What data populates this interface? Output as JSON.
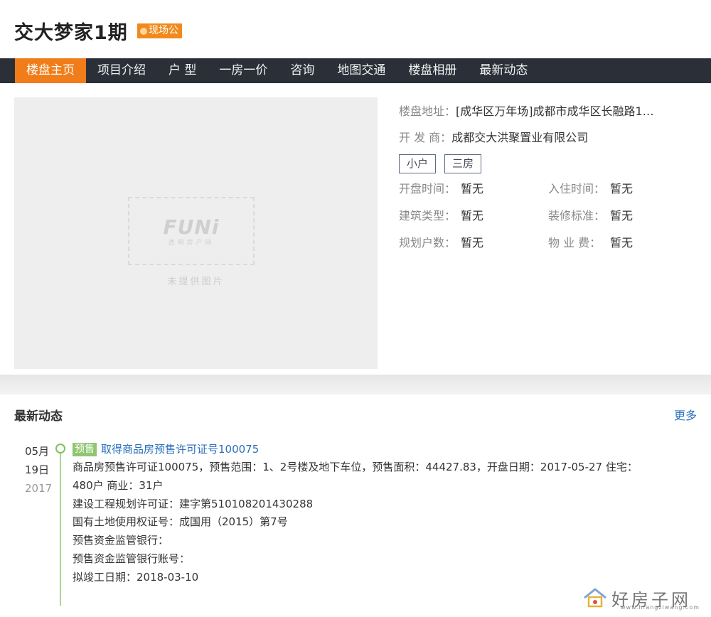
{
  "header": {
    "title": "交大梦家1期",
    "badge": "现场公"
  },
  "nav": {
    "items": [
      "楼盘主页",
      "项目介绍",
      "户 型",
      "一房一价",
      "咨询",
      "地图交通",
      "楼盘相册",
      "最新动态"
    ]
  },
  "photo": {
    "logo": "FUNi",
    "logo_sub": "透明房产网",
    "caption": "未提供图片"
  },
  "info": {
    "address_label": "楼盘地址：",
    "address_value": "[成华区万年场]成都市成华区长融路1…",
    "developer_label": "开 发 商：",
    "developer_value": "成都交大洪聚置业有限公司",
    "tags": [
      "小户",
      "三房"
    ],
    "fields": [
      {
        "label": "开盘时间：",
        "value": "暂无"
      },
      {
        "label": "入住时间：",
        "value": "暂无"
      },
      {
        "label": "建筑类型：",
        "value": "暂无"
      },
      {
        "label": "装修标准：",
        "value": "暂无"
      },
      {
        "label": "规划户数：",
        "value": "暂无"
      },
      {
        "label": "物 业 费：",
        "value": "暂无"
      }
    ]
  },
  "news": {
    "title": "最新动态",
    "more": "更多",
    "item": {
      "month": "05月",
      "day": "19日",
      "year": "2017",
      "tag": "预售",
      "headline": "取得商品房预售许可证号100075",
      "lines": [
        "商品房预售许可证100075，预售范围：1、2号楼及地下车位，预售面积：44427.83，开盘日期：2017-05-27 住宅：",
        "480户 商业：31户",
        "建设工程规划许可证：建字第510108201430288",
        "国有土地使用权证号：成国用（2015）第7号",
        "预售资金监管银行：",
        "预售资金监管银行账号：",
        "拟竣工日期：2018-03-10"
      ]
    }
  },
  "watermark": {
    "text": "好房子网",
    "url": "www.hfangziwang.com"
  },
  "colors": {
    "nav_bg": "#2a2f38",
    "accent": "#f07d1a",
    "link": "#2a6ebb",
    "timeline": "#8fc66f"
  }
}
